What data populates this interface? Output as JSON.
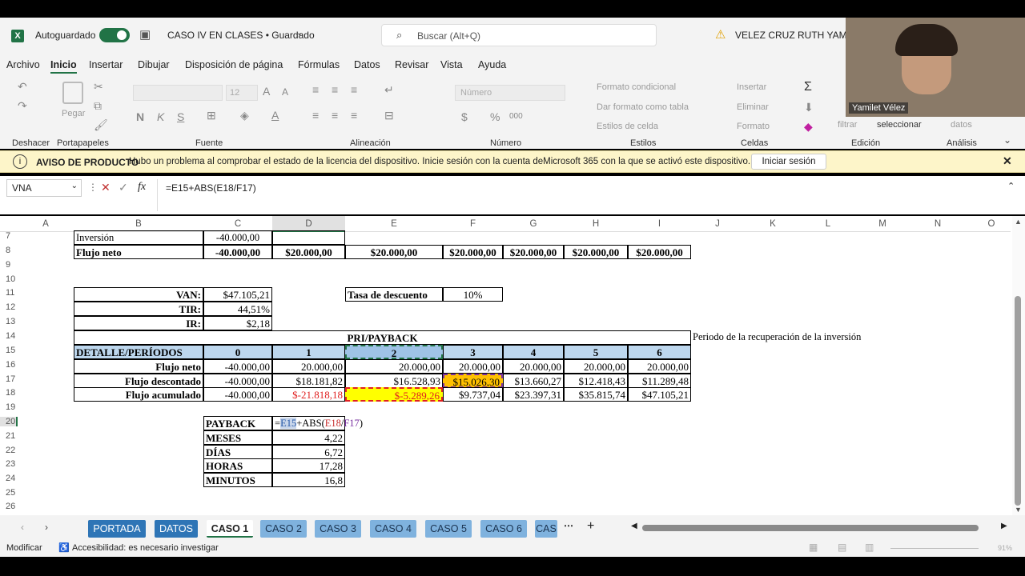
{
  "titlebar": {
    "autosave_label": "Autoguardado",
    "doc_title": "CASO IV EN CLASES • Guardado",
    "search_placeholder": "Buscar (Alt+Q)",
    "user_name": "VELEZ CRUZ RUTH YAMILET"
  },
  "webcam": {
    "label": "Yamilet Vélez"
  },
  "menu": [
    "Archivo",
    "Inicio",
    "Insertar",
    "Dibujar",
    "Disposición de página",
    "Fórmulas",
    "Datos",
    "Revisar",
    "Vista",
    "Ayuda"
  ],
  "ribbon": {
    "groups": [
      "Deshacer",
      "Portapapeles",
      "Fuente",
      "Alineación",
      "Número",
      "Estilos",
      "Celdas",
      "Edición",
      "Análisis"
    ],
    "paste": "Pegar",
    "font_size": "12",
    "number_format": "Número",
    "cond_format": "Formato condicional",
    "table_format": "Dar formato como tabla",
    "cell_styles": "Estilos de celda",
    "insert": "Insertar",
    "delete": "Eliminar",
    "format": "Formato",
    "filter": "filtrar",
    "select": "seleccionar",
    "data": "datos"
  },
  "notice": {
    "title": "AVISO DE PRODUCTO",
    "message": "Hubo un problema al comprobar el estado de la licencia del dispositivo. Inicie sesión con la cuenta deMicrosoft 365 con la que se activó este dispositivo.",
    "button": "Iniciar sesión"
  },
  "formula": {
    "name_box": "VNA",
    "fx": "fx",
    "content": "=E15+ABS(E18/F17)"
  },
  "columns": [
    "A",
    "B",
    "C",
    "D",
    "E",
    "F",
    "G",
    "H",
    "I",
    "J",
    "K",
    "L",
    "M",
    "N",
    "O"
  ],
  "rows": [
    "7",
    "8",
    "9",
    "10",
    "11",
    "12",
    "13",
    "14",
    "15",
    "16",
    "17",
    "18",
    "19",
    "20",
    "21",
    "22",
    "23",
    "24",
    "25",
    "26"
  ],
  "sheet": {
    "inversion": {
      "label": "Inversión",
      "c": "-40.000,00"
    },
    "flujo_neto_top": {
      "label": "Flujo neto",
      "c": "-40.000,00",
      "d": "$20.000,00",
      "e": "$20.000,00",
      "f": "$20.000,00",
      "g": "$20.000,00",
      "h": "$20.000,00",
      "i": "$20.000,00"
    },
    "van": {
      "label": "VAN:",
      "value": "$47.105,21"
    },
    "tir": {
      "label": "TIR:",
      "value": "44,51%"
    },
    "ir": {
      "label": "IR:",
      "value": "$2,18"
    },
    "tasa": {
      "label": "Tasa de descuento",
      "value": "10%"
    },
    "pri_title": "PRI/PAYBACK",
    "pri_note": "Periodo de la recuperación de la inversión",
    "periods": {
      "label": "DETALLE/PERÍODOS",
      "values": [
        "0",
        "1",
        "2",
        "3",
        "4",
        "5",
        "6"
      ]
    },
    "flujo_neto": {
      "label": "Flujo neto",
      "values": [
        "-40.000,00",
        "20.000,00",
        "20.000,00",
        "20.000,00",
        "20.000,00",
        "20.000,00",
        "20.000,00"
      ]
    },
    "flujo_desc": {
      "label": "Flujo descontado",
      "values": [
        "-40.000,00",
        "$18.181,82",
        "$16.528,93",
        "$15.026,30",
        "$13.660,27",
        "$12.418,43",
        "$11.289,48"
      ]
    },
    "flujo_acum": {
      "label": "Flujo acumulado",
      "values": [
        "-40.000,00",
        "$-21.818,18",
        "$-5.289,26",
        "$9.737,04",
        "$23.397,31",
        "$35.815,74",
        "$47.105,21"
      ]
    },
    "payback": {
      "label": "PAYBACK",
      "formula_a": "=",
      "formula_b": "E15",
      "formula_c": "+ABS(",
      "formula_d": "E18",
      "formula_e": "/",
      "formula_f": "F17",
      "formula_g": ")"
    },
    "meses": {
      "label": "MESES",
      "value": "4,22"
    },
    "dias": {
      "label": "DÍAS",
      "value": "6,72"
    },
    "horas": {
      "label": "HORAS",
      "value": "17,28"
    },
    "minutos": {
      "label": "MINUTOS",
      "value": "16,8"
    }
  },
  "tabs": [
    "PORTADA",
    "DATOS",
    "CASO 1",
    "CASO 2",
    "CASO 3",
    "CASO 4",
    "CASO 5",
    "CASO 6",
    "CAS"
  ],
  "status": {
    "mode": "Modificar",
    "accessibility": "Accesibilidad: es necesario investigar",
    "zoom": "91%"
  },
  "colors": {
    "excel_green": "#217346",
    "header_blue": "#bdd7ee",
    "highlight_orange": "#f4b183",
    "highlight_yellow": "#ffc000",
    "red_text": "#e02020"
  }
}
